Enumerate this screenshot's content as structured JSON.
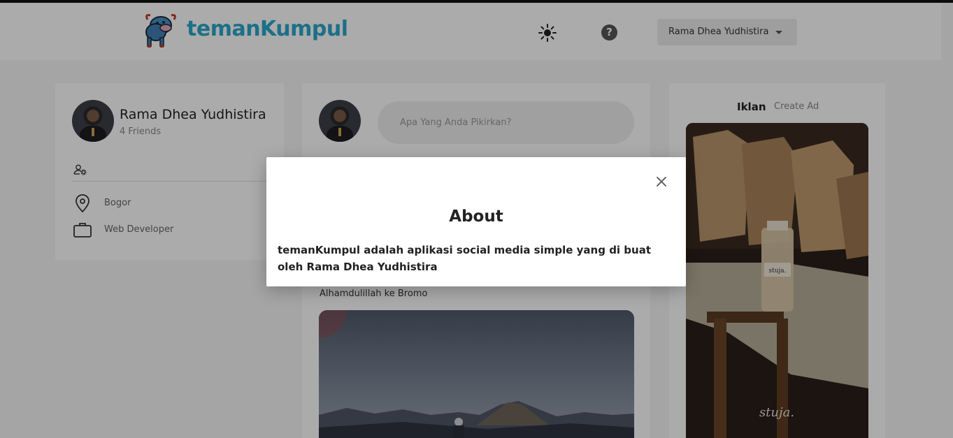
{
  "app": {
    "brand_name": "temanKumpul",
    "brand_color": "#2aa7c9"
  },
  "header": {
    "theme_icon": "sun-icon",
    "help_icon": "help-circle-icon",
    "help_glyph": "?",
    "user_menu_label": "Rama Dhea Yudhistira"
  },
  "profile": {
    "name": "Rama Dhea Yudhistira",
    "friends": "4 Friends",
    "location": "Bogor",
    "occupation": "Web Developer"
  },
  "feed": {
    "post_placeholder": "Apa Yang Anda Pikirkan?",
    "post_caption": "Alhamdulillah ke Bromo"
  },
  "ads": {
    "tab_active": "Iklan",
    "tab_create": "Create Ad",
    "photo_brand_text": "stuja."
  },
  "modal": {
    "title": "About",
    "body": "temanKumpul adalah aplikasi social media simple yang di buat oleh Rama Dhea Yudhistira"
  }
}
